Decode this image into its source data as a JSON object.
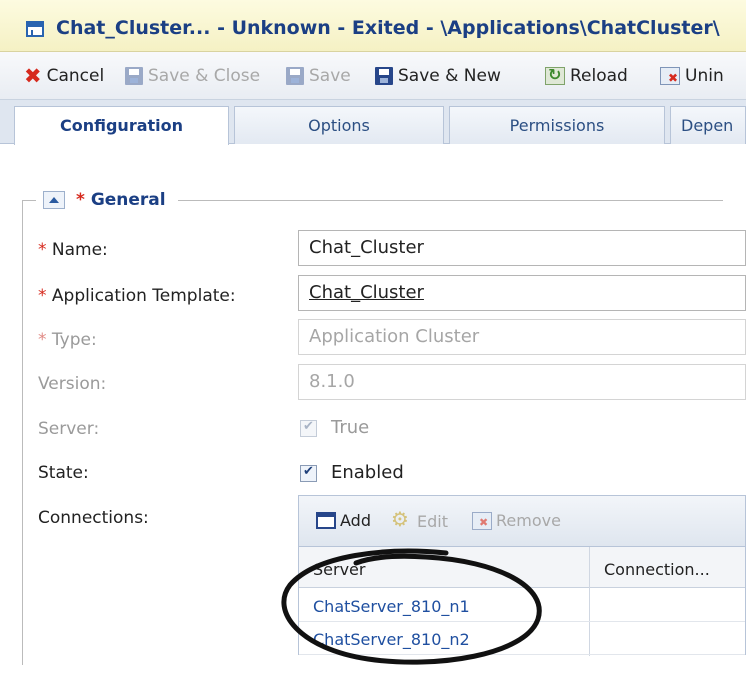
{
  "window": {
    "title": "Chat_Cluster... - Unknown - Exited - \\Applications\\ChatCluster\\"
  },
  "toolbar": {
    "cancel": "Cancel",
    "save_close": "Save & Close",
    "save": "Save",
    "save_new": "Save & New",
    "reload": "Reload",
    "uninstall": "Unin"
  },
  "tabs": [
    {
      "label": "Configuration",
      "active": true
    },
    {
      "label": "Options"
    },
    {
      "label": "Permissions"
    },
    {
      "label": "Depen"
    }
  ],
  "section": {
    "required_mark": "*",
    "title": "General"
  },
  "form": {
    "name": {
      "label": "Name:",
      "value": "Chat_Cluster"
    },
    "template": {
      "label": "Application Template:",
      "value": "Chat_Cluster"
    },
    "type": {
      "label": "Type:",
      "value": "Application Cluster"
    },
    "version": {
      "label": "Version:",
      "value": "8.1.0"
    },
    "server": {
      "label": "Server:",
      "value": "True"
    },
    "state": {
      "label": "State:",
      "value": "Enabled"
    },
    "connections": {
      "label": "Connections:"
    }
  },
  "connections_grid": {
    "add": "Add",
    "edit": "Edit",
    "remove": "Remove",
    "columns": [
      "Server",
      "Connection..."
    ],
    "rows": [
      {
        "server": "ChatServer_810_n1",
        "connection": ""
      },
      {
        "server": "ChatServer_810_n2",
        "connection": ""
      }
    ]
  },
  "colors": {
    "title_text": "#1b3f84",
    "required": "#d62a1e",
    "link": "#1f4fa0"
  }
}
